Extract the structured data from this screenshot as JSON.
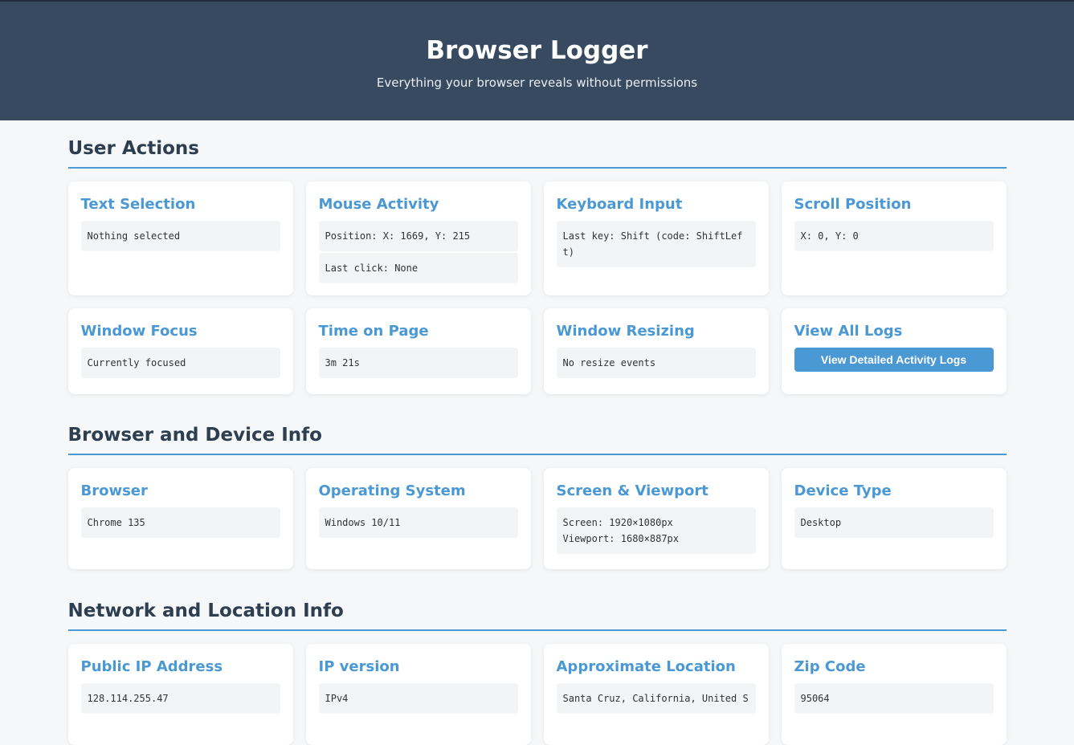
{
  "header": {
    "title": "Browser Logger",
    "subtitle": "Everything your browser reveals without permissions"
  },
  "sections": {
    "user_actions": {
      "title": "User Actions",
      "text_selection": {
        "title": "Text Selection",
        "value": "Nothing selected"
      },
      "mouse_activity": {
        "title": "Mouse Activity",
        "position": "Position: X: 1669, Y: 215",
        "last_click": "Last click: None"
      },
      "keyboard_input": {
        "title": "Keyboard Input",
        "value": "Last key: Shift (code: ShiftLeft)"
      },
      "scroll_position": {
        "title": "Scroll Position",
        "value": "X: 0, Y: 0"
      },
      "window_focus": {
        "title": "Window Focus",
        "value": "Currently focused"
      },
      "time_on_page": {
        "title": "Time on Page",
        "value": "3m 21s"
      },
      "window_resizing": {
        "title": "Window Resizing",
        "value": "No resize events"
      },
      "view_all_logs": {
        "title": "View All Logs",
        "button_label": "View Detailed Activity Logs"
      }
    },
    "browser_device": {
      "title": "Browser and Device Info",
      "browser": {
        "title": "Browser",
        "value": "Chrome 135"
      },
      "os": {
        "title": "Operating System",
        "value": "Windows 10/11"
      },
      "screen": {
        "title": "Screen & Viewport",
        "screen": "Screen: 1920×1080px",
        "viewport": "Viewport: 1680×887px"
      },
      "device_type": {
        "title": "Device Type",
        "value": "Desktop"
      }
    },
    "network_location": {
      "title": "Network and Location Info",
      "public_ip": {
        "title": "Public IP Address",
        "value": "128.114.255.47"
      },
      "ip_version": {
        "title": "IP version",
        "value": "IPv4"
      },
      "location": {
        "title": "Approximate Location",
        "value": "Santa Cruz, California, United S"
      },
      "zip": {
        "title": "Zip Code",
        "value": "95064"
      }
    }
  }
}
